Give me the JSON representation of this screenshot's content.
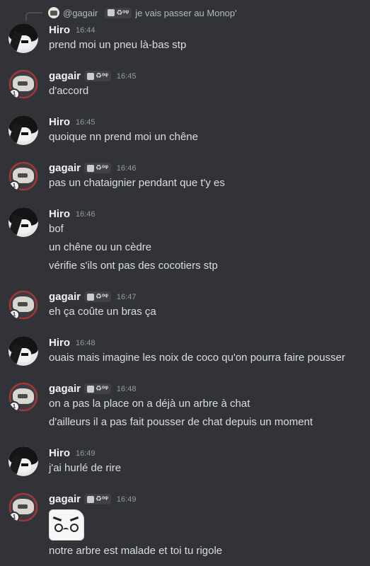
{
  "reply": {
    "author": "@gagair",
    "tag": "♻ᵒᵠ",
    "text": "je vais passer au Monop'"
  },
  "messages": [
    {
      "author": "Hiro",
      "tag": "",
      "time": "16:44",
      "lines": [
        "prend moi un pneu là-bas stp"
      ]
    },
    {
      "author": "gagair",
      "tag": "♻ᵒᵠ",
      "time": "16:45",
      "lines": [
        "d'accord"
      ]
    },
    {
      "author": "Hiro",
      "tag": "",
      "time": "16:45",
      "lines": [
        "quoique nn prend moi un chêne"
      ]
    },
    {
      "author": "gagair",
      "tag": "♻ᵒᵠ",
      "time": "16:46",
      "lines": [
        "pas un chataignier pendant que t'y es"
      ]
    },
    {
      "author": "Hiro",
      "tag": "",
      "time": "16:46",
      "lines": [
        "bof",
        "un chêne ou un cèdre",
        "vérifie s'ils ont pas des cocotiers stp"
      ]
    },
    {
      "author": "gagair",
      "tag": "♻ᵒᵠ",
      "time": "16:47",
      "lines": [
        "eh ça coûte un bras ça"
      ]
    },
    {
      "author": "Hiro",
      "tag": "",
      "time": "16:48",
      "lines": [
        "ouais mais imagine les noix de coco qu'on pourra faire pousser"
      ]
    },
    {
      "author": "gagair",
      "tag": "♻ᵒᵠ",
      "time": "16:48",
      "lines": [
        "on a pas la place on a déjà un arbre à chat",
        "d'ailleurs il a pas fait pousser de chat depuis un moment"
      ]
    },
    {
      "author": "Hiro",
      "tag": "",
      "time": "16:49",
      "lines": [
        "j'ai hurlé de rire"
      ]
    },
    {
      "author": "gagair",
      "tag": "♻ᵒᵠ",
      "time": "16:49",
      "lines": [
        "notre arbre est malade et toi tu rigole"
      ],
      "sticker": "angry-face-sticker"
    }
  ],
  "colors": {
    "background": "#313338",
    "name": "#f2f3f5",
    "text": "#dbdee1",
    "muted": "#949ba4"
  }
}
